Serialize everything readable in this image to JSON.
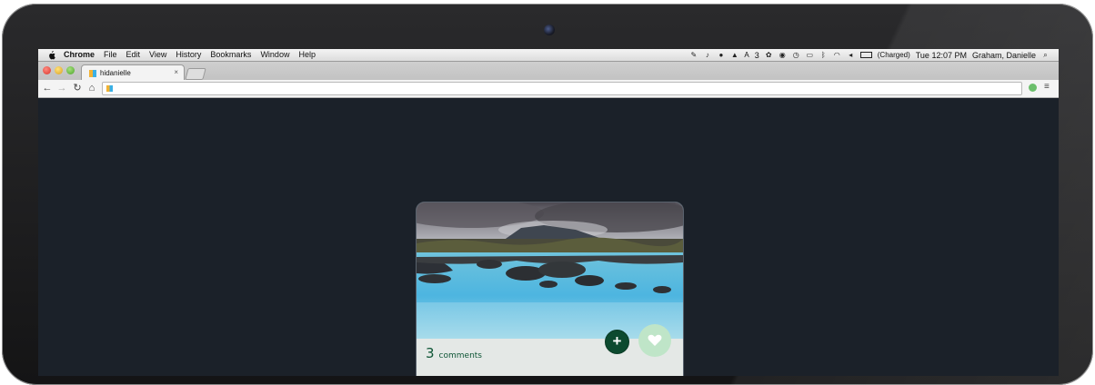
{
  "menubar": {
    "apple_icon": "apple-logo-icon",
    "app_name": "Chrome",
    "items": [
      "File",
      "Edit",
      "View",
      "History",
      "Bookmarks",
      "Window",
      "Help"
    ],
    "status": {
      "notification_count": "3",
      "battery_text": "(Charged)",
      "clock": "Tue 12:07 PM",
      "user": "Graham, Danielle"
    }
  },
  "browser": {
    "tab_title": "hidanielle",
    "tab_close": "×",
    "url_value": "",
    "nav": {
      "back": "←",
      "forward": "→",
      "reload": "↻",
      "home": "⌂"
    },
    "menu_glyph": "≡"
  },
  "card": {
    "comment_count": "3",
    "comment_label": "comments",
    "add_glyph": "+",
    "colors": {
      "accent": "#0c4a2f",
      "like_bg": "#bfe5c8",
      "page_bg": "#1b2129"
    }
  }
}
